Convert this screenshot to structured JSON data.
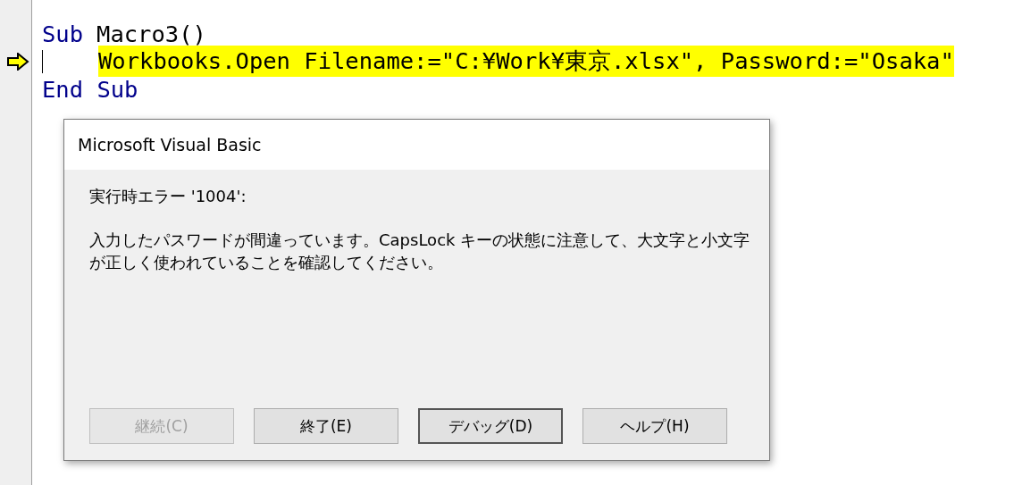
{
  "code": {
    "lines": [
      {
        "tokens": [
          {
            "text": "Sub",
            "kind": "keyword"
          },
          {
            "text": "Macro3()",
            "kind": "plain"
          }
        ],
        "current": false,
        "highlighted": false,
        "children": [
          {
            "tokens": [
              {
                "text": "Workbooks.Open Filename:=\"C:¥Work¥東京.xlsx\", Password:=\"Osaka\"",
                "kind": "plain"
              }
            ],
            "current": true,
            "highlighted": true
          }
        ]
      },
      {
        "tokens": [
          {
            "text": "End Sub",
            "kind": "keyword"
          }
        ],
        "current": false,
        "highlighted": false
      }
    ]
  },
  "dialog": {
    "title": "Microsoft Visual Basic",
    "error_heading": "実行時エラー '1004':",
    "message": "入力したパスワードが間違っています。CapsLock キーの状態に注意して、大文字と小文字が正しく使われていることを確認してください。",
    "buttons": [
      {
        "label": "継続(C)",
        "disabled": true,
        "default": false
      },
      {
        "label": "終了(E)",
        "disabled": false,
        "default": false
      },
      {
        "label": "デバッグ(D)",
        "disabled": false,
        "default": true
      },
      {
        "label": "ヘルプ(H)",
        "disabled": false,
        "default": false
      }
    ]
  }
}
